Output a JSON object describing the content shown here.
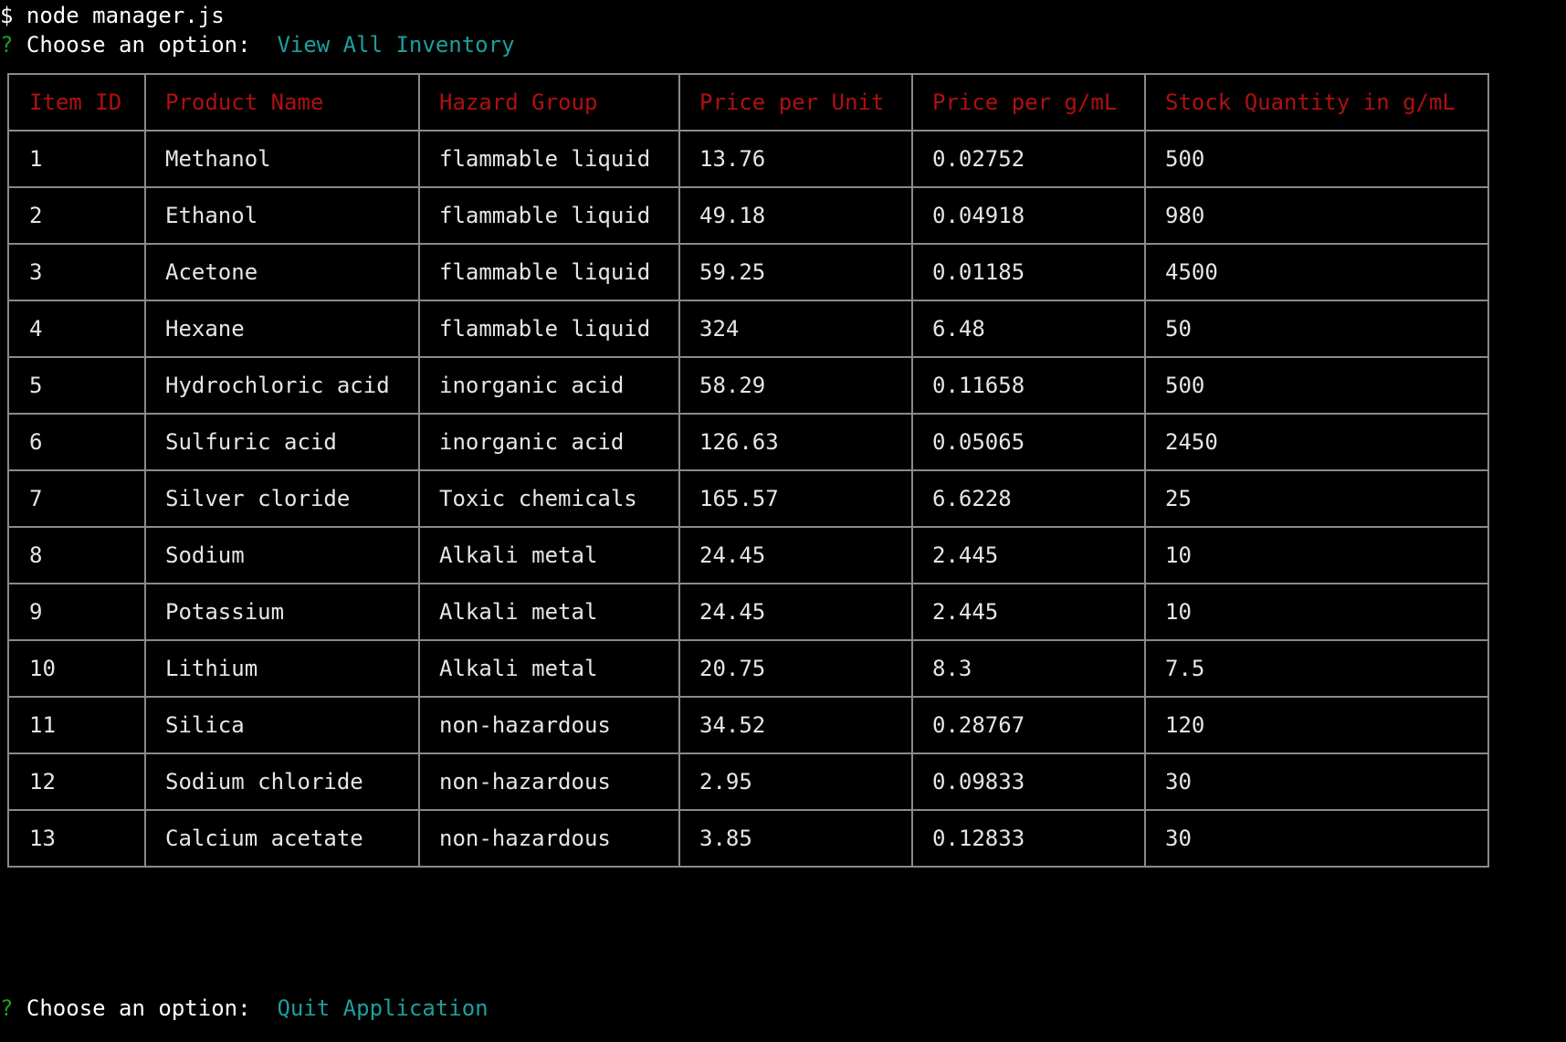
{
  "terminal": {
    "command_prefix": "$",
    "command": " node manager.js",
    "prompt_marker": "?",
    "prompt_label": " Choose an option:  ",
    "first_answer": "View All Inventory",
    "second_answer": "Quit Application"
  },
  "table": {
    "headers": [
      "Item ID",
      "Product Name",
      "Hazard Group",
      "Price per Unit",
      "Price per g/mL",
      "Stock Quantity in g/mL"
    ],
    "rows": [
      [
        "1",
        "Methanol",
        "flammable liquid",
        "13.76",
        "0.02752",
        "500"
      ],
      [
        "2",
        "Ethanol",
        "flammable liquid",
        "49.18",
        "0.04918",
        "980"
      ],
      [
        "3",
        "Acetone",
        "flammable liquid",
        "59.25",
        "0.01185",
        "4500"
      ],
      [
        "4",
        "Hexane",
        "flammable liquid",
        "324",
        "6.48",
        "50"
      ],
      [
        "5",
        "Hydrochloric acid",
        "inorganic acid",
        "58.29",
        "0.11658",
        "500"
      ],
      [
        "6",
        "Sulfuric acid",
        "inorganic acid",
        "126.63",
        "0.05065",
        "2450"
      ],
      [
        "7",
        "Silver cloride",
        "Toxic chemicals",
        "165.57",
        "6.6228",
        "25"
      ],
      [
        "8",
        "Sodium",
        "Alkali metal",
        "24.45",
        "2.445",
        "10"
      ],
      [
        "9",
        "Potassium",
        "Alkali metal",
        "24.45",
        "2.445",
        "10"
      ],
      [
        "10",
        "Lithium",
        "Alkali metal",
        "20.75",
        "8.3",
        "7.5"
      ],
      [
        "11",
        "Silica",
        "non-hazardous",
        "34.52",
        "0.28767",
        "120"
      ],
      [
        "12",
        "Sodium chloride",
        "non-hazardous",
        "2.95",
        "0.09833",
        "30"
      ],
      [
        "13",
        "Calcium acetate",
        "non-hazardous",
        "3.85",
        "0.12833",
        "30"
      ]
    ]
  },
  "colors": {
    "background": "#000000",
    "text": "#ffffff",
    "header_text": "#b01010",
    "answer_text": "#1f9e9e",
    "prompt_marker": "#1aa01a",
    "table_border": "#8a8a8a"
  }
}
